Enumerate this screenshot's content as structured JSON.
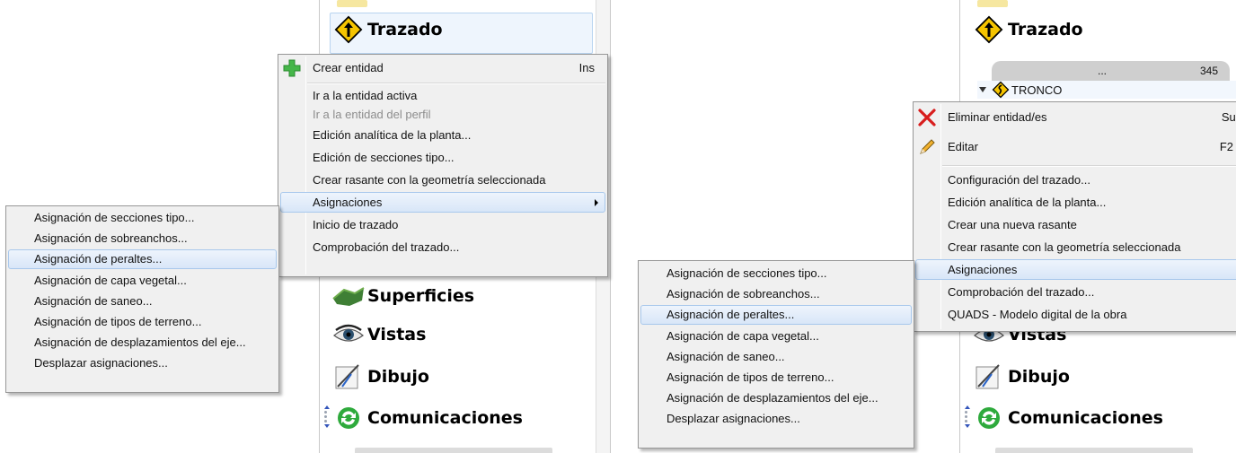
{
  "colors": {
    "menu_bg": "#f0f0f0",
    "highlight": "#d8e6f8",
    "highlight_border": "#a8c8ec",
    "disabled_text": "#8d8d8d"
  },
  "left": {
    "tree": {
      "trazado": "Trazado",
      "superficies": "Superficies",
      "vistas": "Vistas",
      "dibujo": "Dibujo",
      "comunicaciones": "Comunicaciones"
    },
    "context_menu": {
      "items": [
        {
          "label": "Crear entidad",
          "shortcut": "Ins",
          "icon": "plus-icon"
        },
        {
          "label": "Ir a la entidad activa"
        },
        {
          "label": "Ir a la entidad del perfil",
          "disabled": true
        },
        {
          "label": "Edición analítica de la planta..."
        },
        {
          "label": "Edición de secciones tipo..."
        },
        {
          "label": "Crear rasante con la geometría seleccionada"
        },
        {
          "label": "Asignaciones",
          "submenu": true,
          "highlighted": true
        },
        {
          "label": "Inicio de trazado"
        },
        {
          "label": "Comprobación del trazado..."
        }
      ]
    },
    "submenu": {
      "items": [
        {
          "label": "Asignación de secciones tipo..."
        },
        {
          "label": "Asignación de sobreanchos..."
        },
        {
          "label": "Asignación de peraltes...",
          "highlighted": true
        },
        {
          "label": "Asignación de capa vegetal..."
        },
        {
          "label": "Asignación de saneo..."
        },
        {
          "label": "Asignación de tipos de terreno..."
        },
        {
          "label": "Asignación de desplazamientos del eje..."
        },
        {
          "label": "Desplazar asignaciones..."
        }
      ]
    }
  },
  "right": {
    "tree": {
      "trazado": "Trazado",
      "grid_ellipsis": "...",
      "grid_value": "345",
      "tronco": "TRONCO",
      "vistas": "Vistas",
      "dibujo": "Dibujo",
      "comunicaciones": "Comunicaciones"
    },
    "context_menu": {
      "items": [
        {
          "label": "Eliminar entidad/es",
          "shortcut": "Sup",
          "icon": "delete-x-icon"
        },
        {
          "label": "Editar",
          "shortcut": "F2",
          "icon": "pencil-icon"
        },
        {
          "label": "Configuración del trazado..."
        },
        {
          "label": "Edición analítica de la planta..."
        },
        {
          "label": "Crear una nueva rasante"
        },
        {
          "label": "Crear rasante con la geometría seleccionada"
        },
        {
          "label": "Asignaciones",
          "highlighted": true
        },
        {
          "label": "Comprobación del trazado..."
        },
        {
          "label": "QUADS - Modelo digital de la obra"
        }
      ]
    },
    "submenu": {
      "items": [
        {
          "label": "Asignación de secciones tipo..."
        },
        {
          "label": "Asignación de sobreanchos..."
        },
        {
          "label": "Asignación de peraltes...",
          "highlighted": true
        },
        {
          "label": "Asignación de capa vegetal..."
        },
        {
          "label": "Asignación de saneo..."
        },
        {
          "label": "Asignación de tipos de terreno..."
        },
        {
          "label": "Asignación de desplazamientos del eje..."
        },
        {
          "label": "Desplazar asignaciones..."
        }
      ]
    }
  }
}
